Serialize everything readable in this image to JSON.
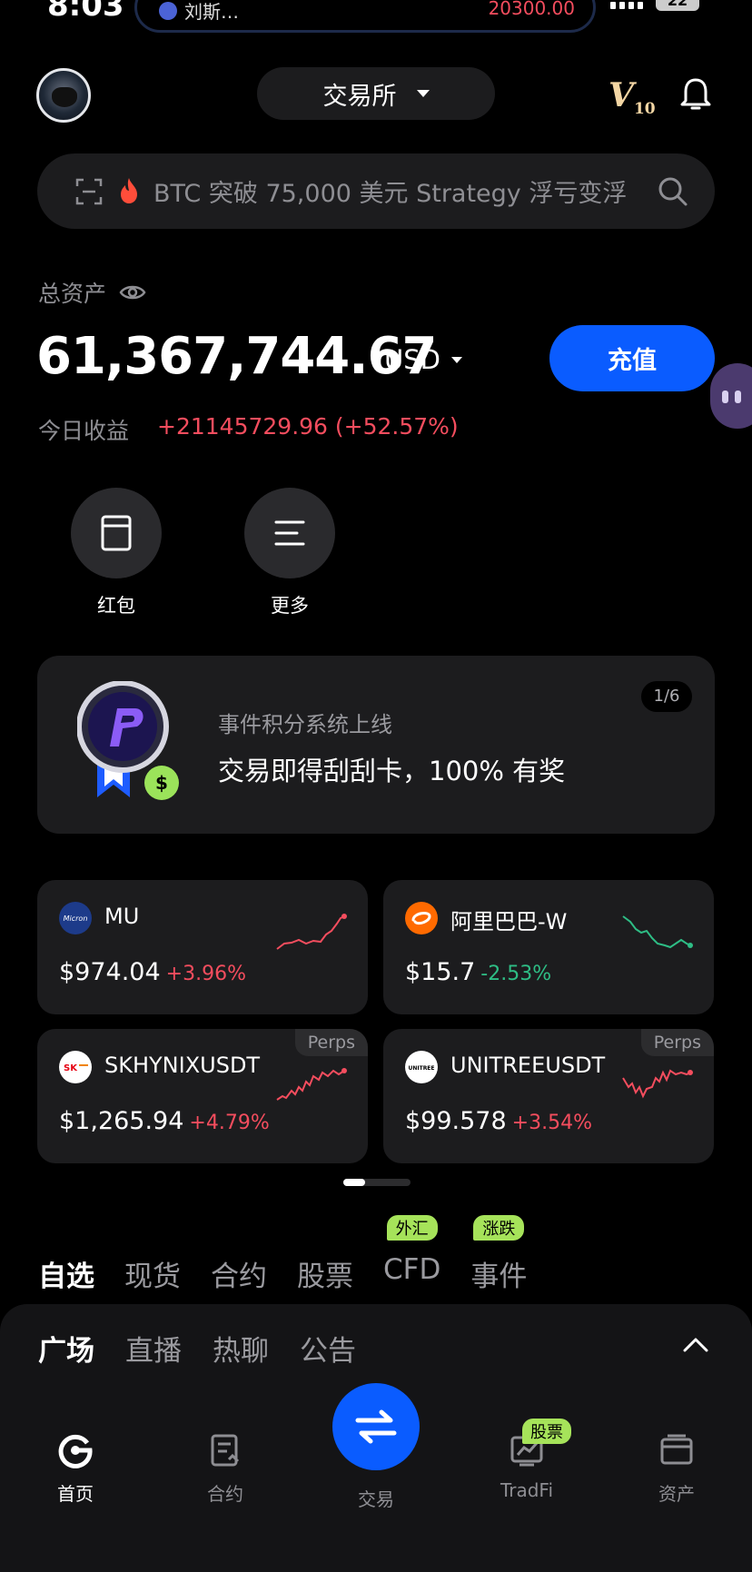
{
  "status_bar": {
    "time": "8:03",
    "island_left": "刘斯…",
    "island_right": "20300.00",
    "battery": "22"
  },
  "header": {
    "exchange_label": "交易所",
    "vip_level": "V",
    "vip_num": "10"
  },
  "search": {
    "placeholder": "BTC 突破 75,000 美元 Strategy 浮亏变浮"
  },
  "assets": {
    "label": "总资产",
    "value": "61,367,744.67",
    "currency": "USD",
    "deposit_label": "充值",
    "pnl_label": "今日收益",
    "pnl_value": "+21145729.96 (+52.57%)"
  },
  "quick_actions": [
    {
      "label": "红包",
      "icon": "red-packet-icon"
    },
    {
      "label": "更多",
      "icon": "menu-icon"
    }
  ],
  "banner": {
    "subtitle": "事件积分系统上线",
    "title": "交易即得刮刮卡，100% 有奖",
    "page": "1/6"
  },
  "cards": [
    {
      "name": "MU",
      "price": "$974.04",
      "change": "+3.96%",
      "direction": "up",
      "logo_text": "Micron",
      "logo_color": "#1d3b8a",
      "perps": ""
    },
    {
      "name": "阿里巴巴-W",
      "price": "$15.7",
      "change": "-2.53%",
      "direction": "down",
      "logo_text": "",
      "logo_color": "#ff6a00",
      "perps": ""
    },
    {
      "name": "SKHYNIXUSDT",
      "price": "$1,265.94",
      "change": "+4.79%",
      "direction": "up",
      "logo_text": "SK",
      "logo_color": "#ffffff",
      "perps": "Perps"
    },
    {
      "name": "UNITREEUSDT",
      "price": "$99.578",
      "change": "+3.54%",
      "direction": "up",
      "logo_text": "UNITREE",
      "logo_color": "#ffffff",
      "perps": "Perps"
    }
  ],
  "market_tabs": [
    {
      "label": "自选",
      "active": true,
      "tag": ""
    },
    {
      "label": "现货",
      "active": false,
      "tag": ""
    },
    {
      "label": "合约",
      "active": false,
      "tag": ""
    },
    {
      "label": "股票",
      "active": false,
      "tag": ""
    },
    {
      "label": "CFD",
      "active": false,
      "tag": "外汇"
    },
    {
      "label": "事件",
      "active": false,
      "tag": "涨跌"
    }
  ],
  "community_tabs": [
    {
      "label": "广场",
      "active": true
    },
    {
      "label": "直播",
      "active": false
    },
    {
      "label": "热聊",
      "active": false
    },
    {
      "label": "公告",
      "active": false
    }
  ],
  "bottom_nav": {
    "home": "首页",
    "futures": "合约",
    "trade": "交易",
    "tradfi": "TradFi",
    "tradfi_tag": "股票",
    "assets": "资产"
  },
  "colors": {
    "accent": "#0a5cff",
    "up": "#f44d5e",
    "down": "#2ebd85",
    "tag": "#a6e35a",
    "vip": "#f3d6a4"
  }
}
